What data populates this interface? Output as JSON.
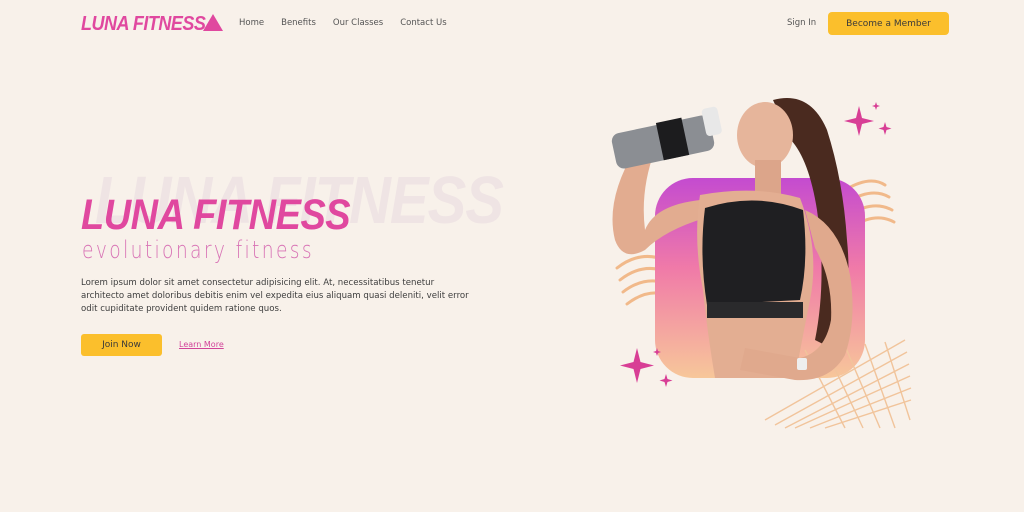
{
  "brand": {
    "logo_text": "LUNA FITNESS",
    "accent_color": "#e0489f",
    "button_color": "#fbbf2c",
    "background_color": "#f8f1ea"
  },
  "nav": {
    "items": [
      {
        "label": "Home"
      },
      {
        "label": "Benefits"
      },
      {
        "label": "Our Classes"
      },
      {
        "label": "Contact Us"
      }
    ],
    "sign_in": "Sign In",
    "cta": "Become a Member"
  },
  "hero": {
    "ghost_title": "LUNA FITNESS",
    "title": "LUNA FITNESS",
    "subtitle": "evolutionary fitness",
    "description": "Lorem ipsum dolor sit amet consectetur adipisicing elit. At, necessitatibus tenetur architecto amet doloribus debitis enim vel expedita eius aliquam quasi deleniti, velit error odit cupiditate provident quidem ratione quos.",
    "primary_button": "Join Now",
    "secondary_link": "Learn More",
    "image_icon": "woman-drinking-water-illustration"
  }
}
